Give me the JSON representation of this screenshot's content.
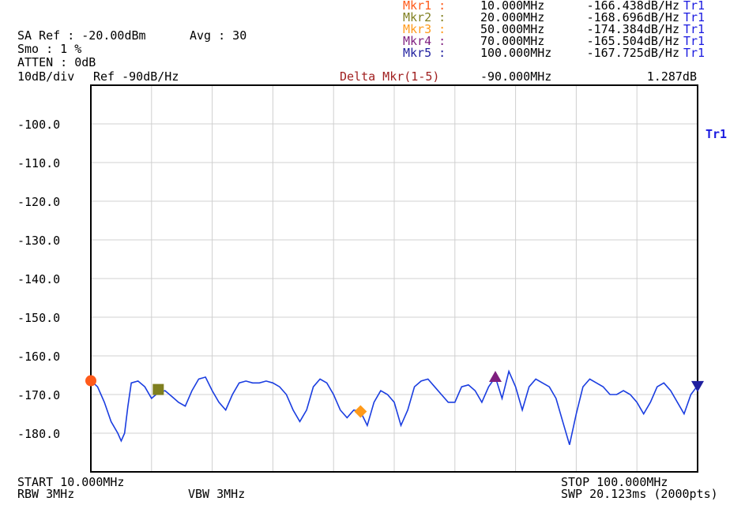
{
  "header": {
    "sa_ref": "SA Ref : -20.00dBm",
    "avg": "Avg : 30",
    "smo": "Smo : 1 %",
    "atten": "ATTEN : 0dB",
    "scale": "10dB/div",
    "ref": "Ref -90dB/Hz"
  },
  "markers": [
    {
      "label": "Mkr1 :",
      "freq": "10.000MHz",
      "value": "-166.438dB/Hz",
      "trace": "Tr1",
      "color": "#ff5a1a",
      "shape": "circle"
    },
    {
      "label": "Mkr2 :",
      "freq": "20.000MHz",
      "value": "-168.696dB/Hz",
      "trace": "Tr1",
      "color": "#7f7f1f",
      "shape": "square"
    },
    {
      "label": "Mkr3 :",
      "freq": "50.000MHz",
      "value": "-174.384dB/Hz",
      "trace": "Tr1",
      "color": "#ff9a1a",
      "shape": "diamond"
    },
    {
      "label": "Mkr4 :",
      "freq": "70.000MHz",
      "value": "-165.504dB/Hz",
      "trace": "Tr1",
      "color": "#7f1f7f",
      "shape": "triangle-up"
    },
    {
      "label": "Mkr5 :",
      "freq": "100.000MHz",
      "value": "-167.725dB/Hz",
      "trace": "Tr1",
      "color": "#1f1f9f",
      "shape": "triangle-down"
    }
  ],
  "delta": {
    "label": "Delta Mkr(1-5)",
    "freq": "-90.000MHz",
    "value": "1.287dB",
    "color": "#a02020"
  },
  "trace_label": "Tr1",
  "footer": {
    "start": "START 10.000MHz",
    "stop": "STOP 100.000MHz",
    "rbw": "RBW 3MHz",
    "vbw": "VBW 3MHz",
    "swp": "SWP 20.123ms (2000pts)"
  },
  "colors": {
    "trace": "#1a3de0",
    "grid": "#d0d0d0",
    "trace_label": "#1a1ae0"
  },
  "chart_data": {
    "type": "line",
    "xlim": [
      10,
      100
    ],
    "ylim": [
      -190,
      -90
    ],
    "yticks": [
      "-100.0",
      "-110.0",
      "-120.0",
      "-130.0",
      "-140.0",
      "-150.0",
      "-160.0",
      "-170.0",
      "-180.0"
    ],
    "ytick_values": [
      -100,
      -110,
      -120,
      -130,
      -140,
      -150,
      -160,
      -170,
      -180
    ],
    "series": [
      {
        "x": [
          10,
          11,
          12,
          13,
          14,
          14.5,
          15,
          15.5,
          16,
          17,
          18,
          19,
          20,
          21,
          22,
          23,
          24,
          25,
          26,
          27,
          28,
          29,
          30,
          31,
          32,
          33,
          34,
          35,
          36,
          37,
          38,
          39,
          40,
          41,
          42,
          43,
          44,
          45,
          46,
          47,
          48,
          49,
          50,
          51,
          52,
          53,
          54,
          55,
          56,
          57,
          58,
          59,
          60,
          61,
          62,
          63,
          64,
          65,
          66,
          67,
          68,
          69,
          70,
          71,
          72,
          73,
          74,
          75,
          76,
          77,
          78,
          79,
          80,
          81,
          82,
          83,
          84,
          85,
          86,
          87,
          88,
          89,
          90,
          91,
          92,
          93,
          94,
          95,
          96,
          97,
          98,
          99,
          100
        ],
        "y": [
          -166.4,
          -168,
          -172,
          -177,
          -180,
          -182,
          -180,
          -173,
          -167,
          -166.5,
          -168,
          -171,
          -169.5,
          -169,
          -170.5,
          -172,
          -173,
          -169,
          -166,
          -165.5,
          -169,
          -172,
          -174,
          -170,
          -167,
          -166.5,
          -167,
          -167,
          -166.5,
          -167,
          -168,
          -170,
          -174,
          -177,
          -174,
          -168,
          -166,
          -167,
          -170,
          -174,
          -176,
          -174,
          -174.4,
          -178,
          -172,
          -169,
          -170,
          -172,
          -178,
          -174,
          -168,
          -166.5,
          -166,
          -168,
          -170,
          -172,
          -172,
          -168,
          -167.5,
          -169,
          -172,
          -168,
          -165.5,
          -171,
          -164,
          -168,
          -174,
          -168,
          -166,
          -167,
          -168,
          -171,
          -177,
          -183,
          -175,
          -168,
          -166,
          -167,
          -168,
          -170,
          -170,
          -169,
          -170,
          -172,
          -175,
          -172,
          -168,
          -167,
          -169,
          -172,
          -175,
          -170,
          -167.7
        ]
      }
    ],
    "marker_points": [
      {
        "x": 10,
        "y": -166.438
      },
      {
        "x": 20,
        "y": -168.696
      },
      {
        "x": 50,
        "y": -174.384
      },
      {
        "x": 70,
        "y": -165.504
      },
      {
        "x": 100,
        "y": -167.725
      }
    ]
  }
}
